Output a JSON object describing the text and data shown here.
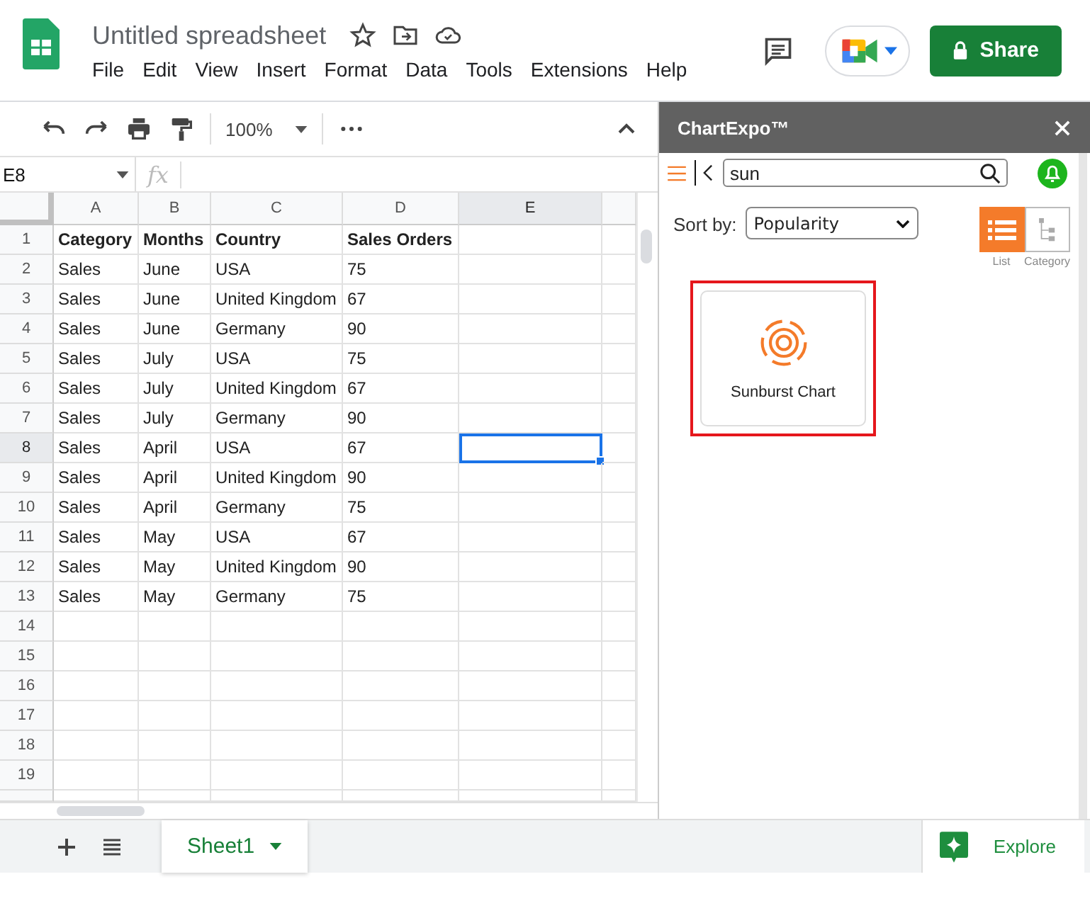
{
  "doc": {
    "title": "Untitled spreadsheet",
    "menu": [
      "File",
      "Edit",
      "View",
      "Insert",
      "Format",
      "Data",
      "Tools",
      "Extensions",
      "Help"
    ],
    "share": "Share"
  },
  "toolbar": {
    "zoom": "100%"
  },
  "formula_bar": {
    "name_box": "E8",
    "fx": "fx"
  },
  "columns": [
    {
      "label": "A",
      "selected": false
    },
    {
      "label": "B",
      "selected": false
    },
    {
      "label": "C",
      "selected": false
    },
    {
      "label": "D",
      "selected": false
    },
    {
      "label": "E",
      "selected": true
    }
  ],
  "rows": [
    {
      "number": "1",
      "bold": true,
      "selected": false,
      "cells": [
        "Category",
        "Months",
        "Country",
        "Sales Orders"
      ]
    },
    {
      "number": "2",
      "bold": false,
      "selected": false,
      "cells": [
        "Sales",
        "June",
        "USA",
        "75"
      ]
    },
    {
      "number": "3",
      "bold": false,
      "selected": false,
      "cells": [
        "Sales",
        "June",
        "United Kingdom",
        "67"
      ]
    },
    {
      "number": "4",
      "bold": false,
      "selected": false,
      "cells": [
        "Sales",
        "June",
        "Germany",
        "90"
      ]
    },
    {
      "number": "5",
      "bold": false,
      "selected": false,
      "cells": [
        "Sales",
        "July",
        "USA",
        "75"
      ]
    },
    {
      "number": "6",
      "bold": false,
      "selected": false,
      "cells": [
        "Sales",
        "July",
        "United Kingdom",
        "67"
      ]
    },
    {
      "number": "7",
      "bold": false,
      "selected": false,
      "cells": [
        "Sales",
        "July",
        "Germany",
        "90"
      ]
    },
    {
      "number": "8",
      "bold": false,
      "selected": true,
      "cells": [
        "Sales",
        "April",
        "USA",
        "67"
      ]
    },
    {
      "number": "9",
      "bold": false,
      "selected": false,
      "cells": [
        "Sales",
        "April",
        "United Kingdom",
        "90"
      ]
    },
    {
      "number": "10",
      "bold": false,
      "selected": false,
      "cells": [
        "Sales",
        "April",
        "Germany",
        "75"
      ]
    },
    {
      "number": "11",
      "bold": false,
      "selected": false,
      "cells": [
        "Sales",
        "May",
        "USA",
        "67"
      ]
    },
    {
      "number": "12",
      "bold": false,
      "selected": false,
      "cells": [
        "Sales",
        "May",
        "United Kingdom",
        "90"
      ]
    },
    {
      "number": "13",
      "bold": false,
      "selected": false,
      "cells": [
        "Sales",
        "May",
        "Germany",
        "75"
      ]
    },
    {
      "number": "14",
      "selected": false
    },
    {
      "number": "15",
      "selected": false
    },
    {
      "number": "16",
      "selected": false
    },
    {
      "number": "17",
      "selected": false
    },
    {
      "number": "18",
      "selected": false
    },
    {
      "number": "19",
      "selected": false
    }
  ],
  "sheets": [
    {
      "label": "Sheet1",
      "selected": true
    }
  ],
  "explore": "Explore",
  "panel": {
    "title": "ChartExpo™",
    "search": "sun",
    "sort_label": "Sort by:",
    "sort_value": "Popularity",
    "views": [
      {
        "label": "List",
        "kind": "list",
        "selected": true
      },
      {
        "label": "Category",
        "kind": "category",
        "selected": false
      }
    ],
    "results": [
      {
        "label": "Sunburst Chart",
        "highlighted": true
      }
    ]
  }
}
